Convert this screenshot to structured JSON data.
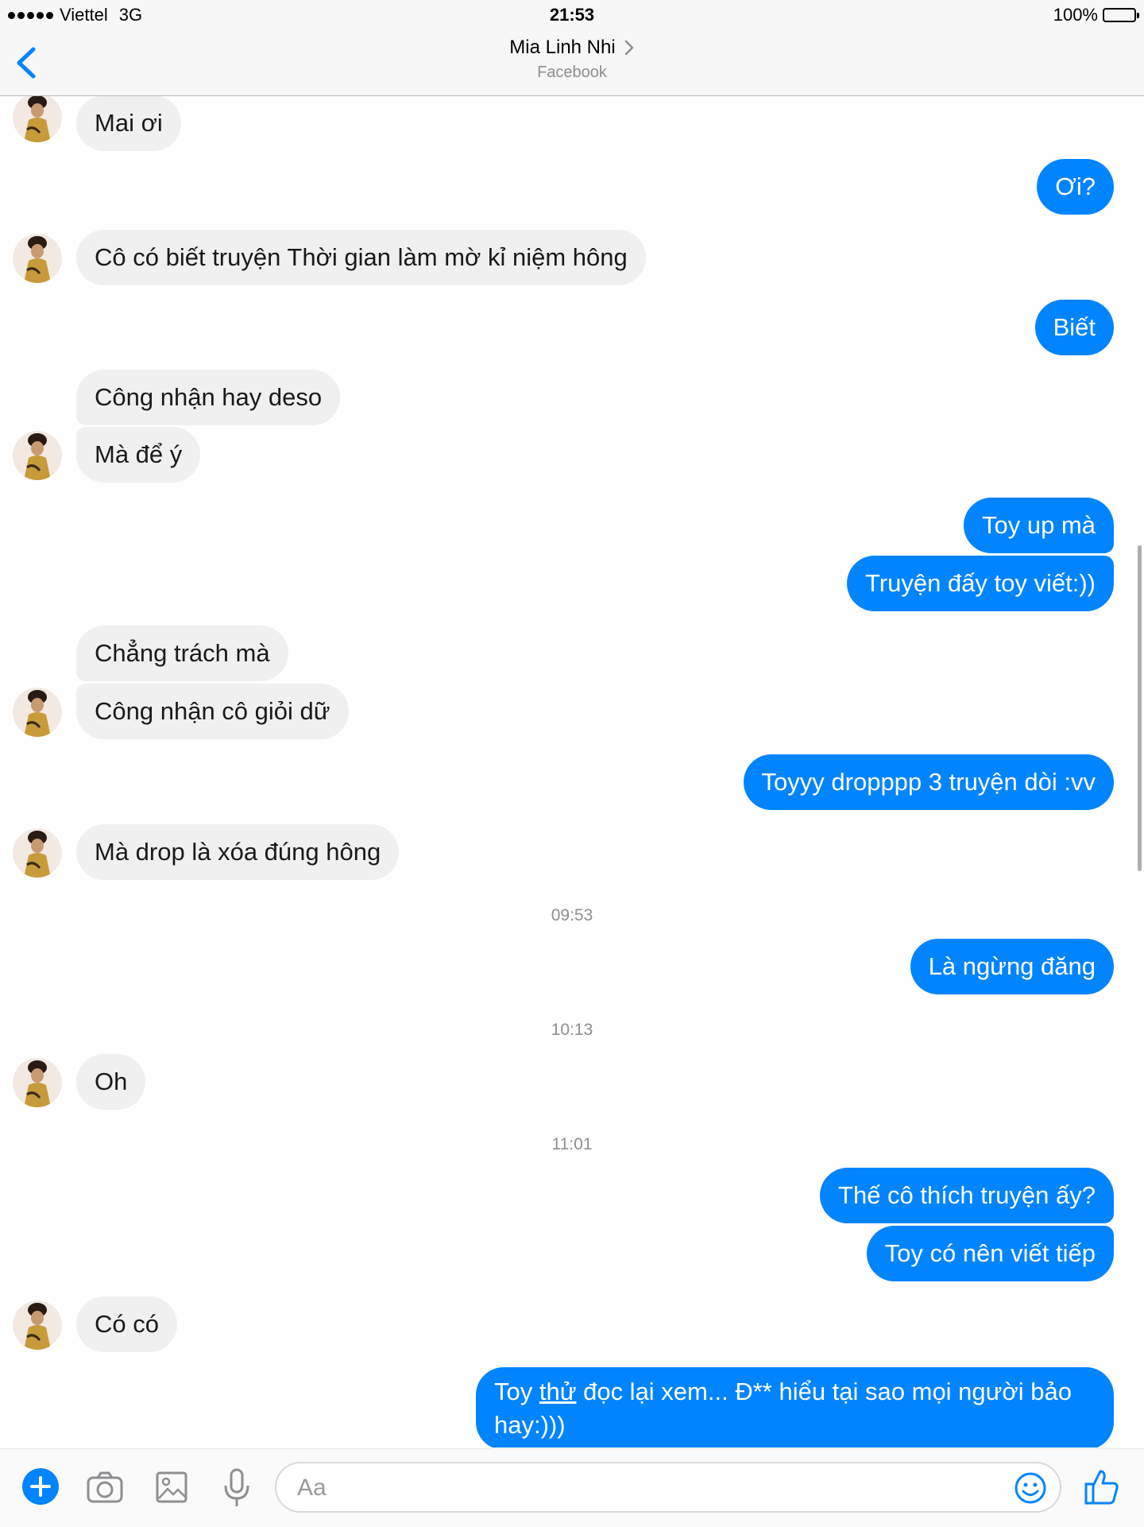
{
  "status_bar": {
    "carrier": "Viettel",
    "network": "3G",
    "time": "21:53",
    "battery": "100%"
  },
  "nav": {
    "title": "Mia Linh Nhi",
    "subtitle": "Facebook"
  },
  "messages": [
    {
      "from": "other",
      "text": "Mai ơi"
    },
    {
      "from": "me",
      "text": "Ơi?"
    },
    {
      "from": "other",
      "text": "Cô có biết truyện Thời gian làm mờ kỉ niệm hông"
    },
    {
      "from": "me",
      "text": "Biết"
    },
    {
      "from": "other",
      "text": "Công nhận hay deso"
    },
    {
      "from": "other",
      "text": "Mà để ý"
    },
    {
      "from": "me",
      "text": "Toy up mà"
    },
    {
      "from": "me",
      "text": "Truyện đấy toy viết:))"
    },
    {
      "from": "other",
      "text": "Chẳng trách mà"
    },
    {
      "from": "other",
      "text": "Công nhận cô giỏi dữ"
    },
    {
      "from": "me",
      "text": "Toyyy dropppp 3 truyện dòi :vv"
    },
    {
      "from": "other",
      "text": "Mà drop là xóa đúng hông"
    },
    {
      "from": "me",
      "text": "Là ngừng đăng"
    },
    {
      "from": "other",
      "text": "Oh"
    },
    {
      "from": "me",
      "text": "Thế cô thích truyện ấy?"
    },
    {
      "from": "me",
      "text": "Toy có nên viết tiếp"
    },
    {
      "from": "other",
      "text": "Có có"
    },
    {
      "from": "me",
      "parts": [
        "Toy ",
        "thử",
        " đọc lại xem... Đ**  hiểu tại sao mọi người bảo hay:)))"
      ]
    }
  ],
  "timestamps": [
    "09:53",
    "10:13",
    "11:01"
  ],
  "composer": {
    "placeholder": "Aa"
  },
  "icons": {
    "back": "chevron-left-icon",
    "title_chevron": "chevron-right-icon",
    "add": "plus-circle-icon",
    "camera": "camera-icon",
    "gallery": "image-icon",
    "mic": "microphone-icon",
    "emoji": "smiley-icon",
    "like": "thumbs-up-icon"
  },
  "colors": {
    "accent": "#0084ff",
    "incoming_bubble": "#f1f0f0",
    "outgoing_text": "#ffffff",
    "timestamp": "#8e8e93"
  }
}
